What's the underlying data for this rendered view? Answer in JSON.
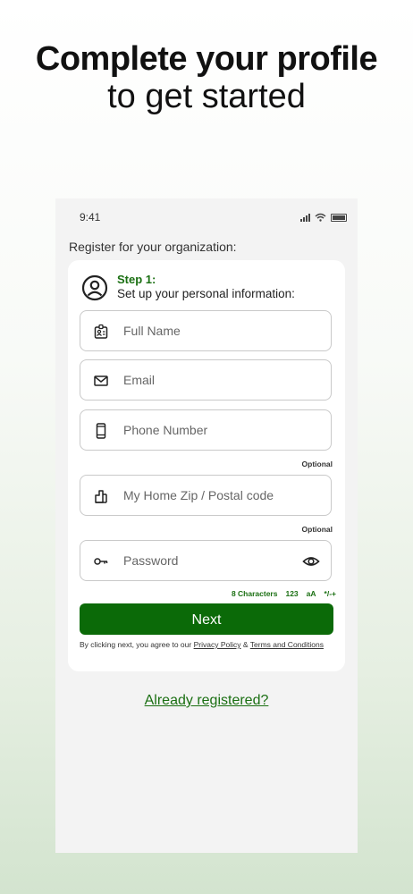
{
  "hero": {
    "title": "Complete your profile",
    "subtitle": "to get started"
  },
  "status": {
    "time": "9:41"
  },
  "register_label": "Register for your organization:",
  "step": {
    "title": "Step 1:",
    "description": "Set up your personal information:"
  },
  "fields": {
    "full_name": "Full Name",
    "email": "Email",
    "phone": "Phone Number",
    "phone_optional": "Optional",
    "zip": "My Home Zip / Postal code",
    "zip_optional": "Optional",
    "password": "Password"
  },
  "password_hints": [
    "8 Characters",
    "123",
    "aA",
    "*/-+"
  ],
  "next_label": "Next",
  "terms": {
    "prefix": "By clicking next, you agree to our",
    "privacy": "Privacy Policy",
    "amp": "&",
    "terms": "Terms and Conditions"
  },
  "already_registered": "Already registered?",
  "colors": {
    "accent": "#0b6a08",
    "accent_text": "#1a6f12"
  },
  "icons": [
    "user-circle-icon",
    "id-badge-icon",
    "mail-icon",
    "phone-icon",
    "home-icon",
    "key-icon",
    "eye-icon"
  ]
}
